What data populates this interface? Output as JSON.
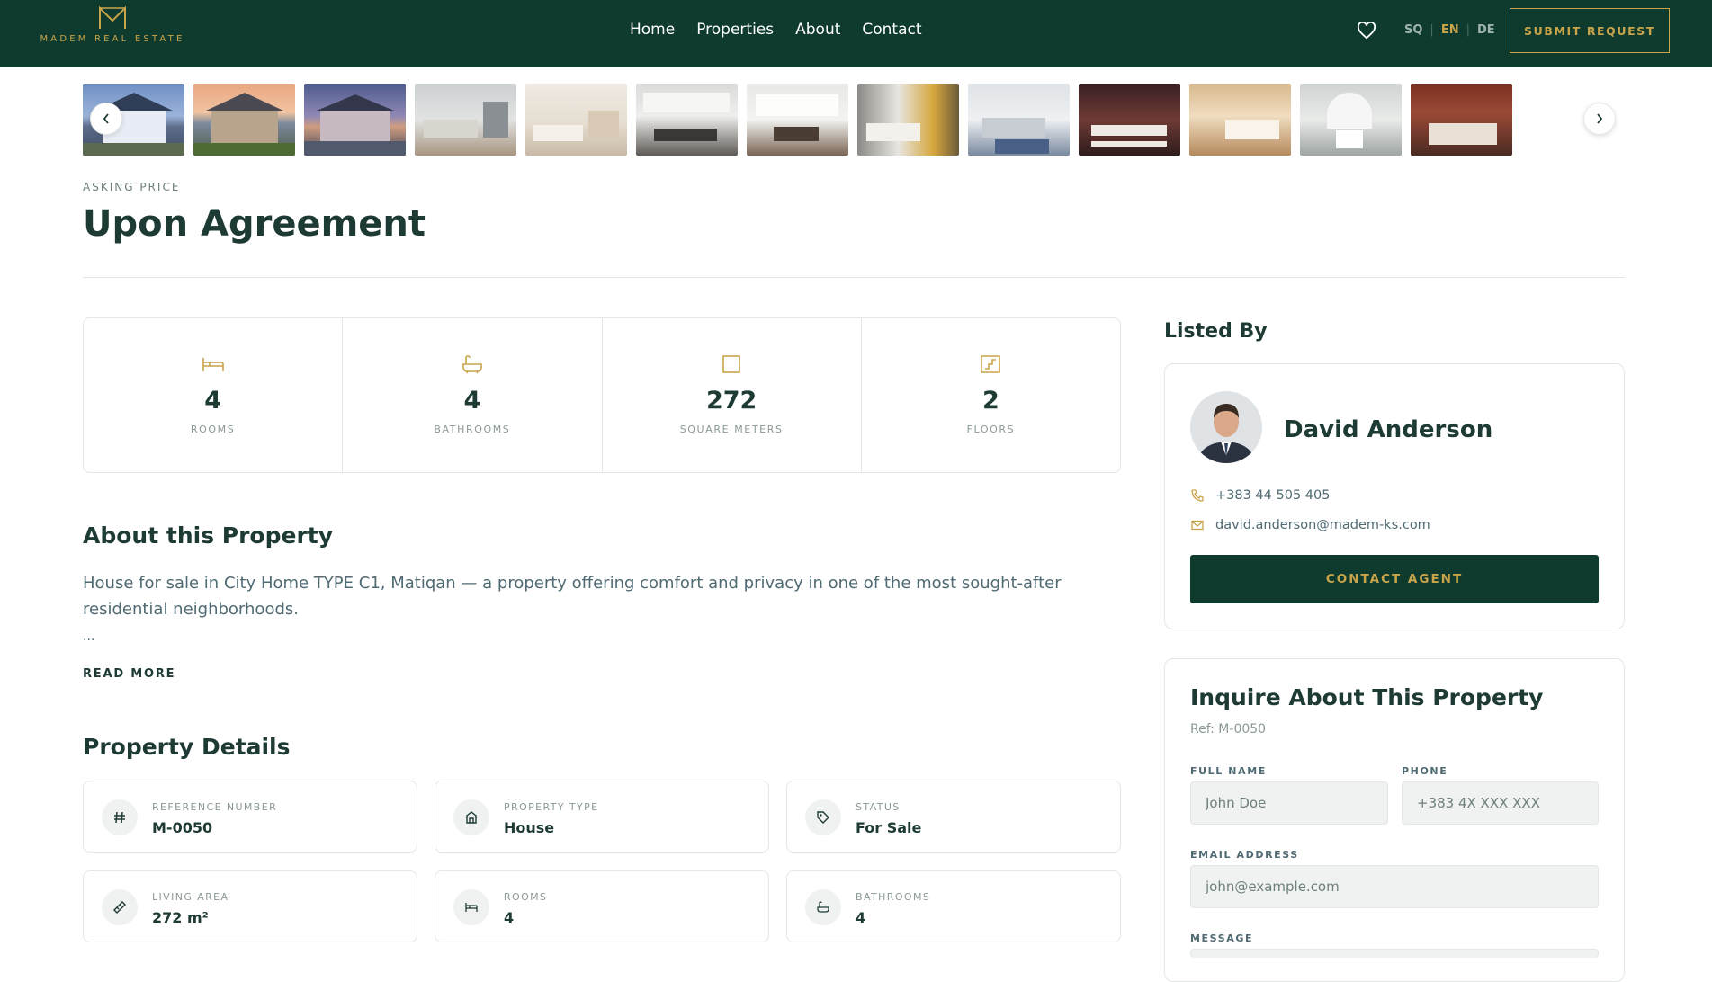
{
  "header": {
    "brand": "MADEM REAL ESTATE",
    "nav": [
      "Home",
      "Properties",
      "About",
      "Contact"
    ],
    "languages": [
      "SQ",
      "EN",
      "DE"
    ],
    "active_language": "EN",
    "submit_label": "SUBMIT REQUEST"
  },
  "gallery": {
    "thumbnails": [
      "house-exterior-blue",
      "house-exterior-sunset",
      "house-exterior-dusk",
      "living-room",
      "open-living-area",
      "kitchen-white",
      "kitchen-island",
      "kitchen-wood",
      "living-room-rug",
      "bedroom-dark",
      "bedroom-warm",
      "bathroom",
      "bedroom-brick"
    ]
  },
  "price": {
    "label": "ASKING PRICE",
    "value": "Upon Agreement"
  },
  "stats": [
    {
      "icon": "bed-icon",
      "value": "4",
      "label": "ROOMS"
    },
    {
      "icon": "bathtub-icon",
      "value": "4",
      "label": "BATHROOMS"
    },
    {
      "icon": "square-icon",
      "value": "272",
      "label": "SQUARE METERS"
    },
    {
      "icon": "stairs-icon",
      "value": "2",
      "label": "FLOORS"
    }
  ],
  "about": {
    "title": "About this Property",
    "text": "House for sale in City Home TYPE C1, Matiqan — a property offering comfort and privacy in one of the most sought-after residential neighborhoods.",
    "ellipsis": "...",
    "read_more": "READ MORE"
  },
  "details": {
    "title": "Property Details",
    "items": [
      {
        "icon": "hash-icon",
        "label": "REFERENCE NUMBER",
        "value": "M-0050"
      },
      {
        "icon": "house-icon",
        "label": "PROPERTY TYPE",
        "value": "House"
      },
      {
        "icon": "tag-icon",
        "label": "STATUS",
        "value": "For Sale"
      },
      {
        "icon": "ruler-icon",
        "label": "LIVING AREA",
        "value": "272 m²"
      },
      {
        "icon": "bed-icon",
        "label": "ROOMS",
        "value": "4"
      },
      {
        "icon": "bathtub-icon",
        "label": "BATHROOMS",
        "value": "4"
      }
    ]
  },
  "agent": {
    "section_title": "Listed By",
    "name": "David Anderson",
    "phone": "+383 44 505 405",
    "email": "david.anderson@madem-ks.com",
    "contact_label": "CONTACT AGENT"
  },
  "inquiry": {
    "title": "Inquire About This Property",
    "ref": "Ref: M-0050",
    "full_name_label": "FULL NAME",
    "full_name_placeholder": "John Doe",
    "phone_label": "PHONE",
    "phone_placeholder": "+383 4X XXX XXX",
    "email_label": "EMAIL ADDRESS",
    "email_placeholder": "john@example.com",
    "message_label": "MESSAGE"
  },
  "colors": {
    "primary": "#0e3b2e",
    "accent": "#c9a44a",
    "text": "#1d3a35"
  }
}
